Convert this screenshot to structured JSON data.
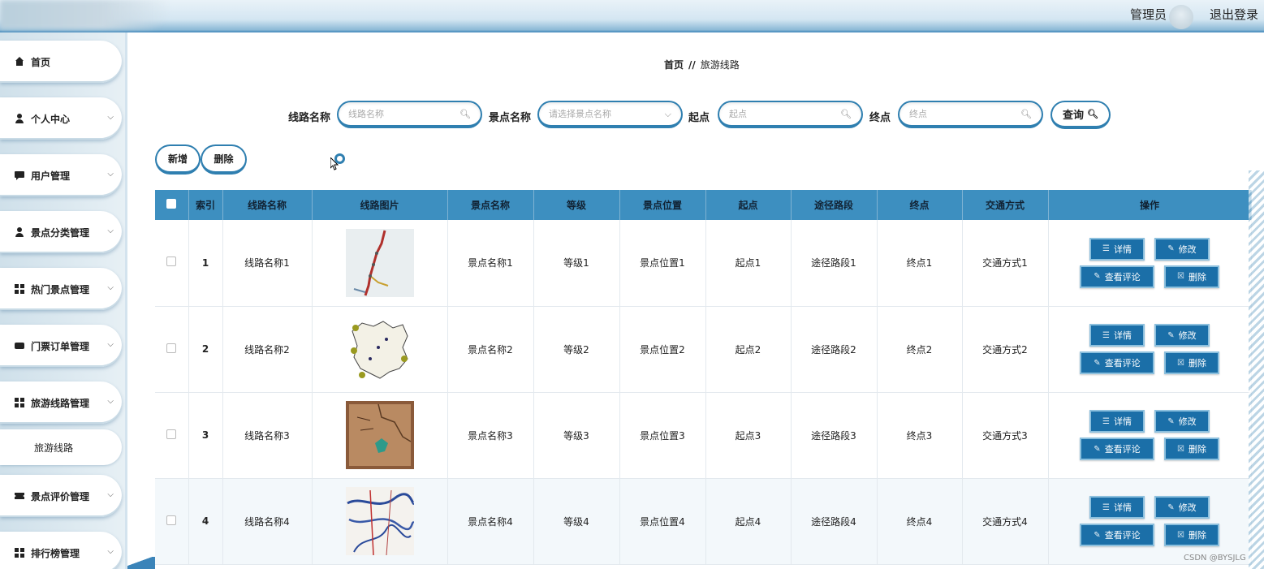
{
  "header": {
    "admin_label": "管理员",
    "logout_label": "退出登录"
  },
  "sidebar": {
    "items": [
      {
        "label": "首页",
        "icon": "home-icon",
        "expandable": false
      },
      {
        "label": "个人中心",
        "icon": "user-icon",
        "expandable": true
      },
      {
        "label": "用户管理",
        "icon": "chat-icon",
        "expandable": true
      },
      {
        "label": "景点分类管理",
        "icon": "user-icon",
        "expandable": true
      },
      {
        "label": "热门景点管理",
        "icon": "grid-icon",
        "expandable": true
      },
      {
        "label": "门票订单管理",
        "icon": "ticket-icon",
        "expandable": true
      },
      {
        "label": "旅游线路管理",
        "icon": "grid-icon",
        "expandable": true
      },
      {
        "label": "景点评价管理",
        "icon": "ticket-icon",
        "expandable": true
      },
      {
        "label": "排行榜管理",
        "icon": "grid-icon",
        "expandable": true
      }
    ],
    "submenu": {
      "label": "旅游线路"
    }
  },
  "breadcrumb": {
    "home": "首页",
    "separator": "//",
    "current": "旅游线路"
  },
  "search": {
    "route_name_label": "线路名称",
    "route_name_placeholder": "线路名称",
    "spot_name_label": "景点名称",
    "spot_name_placeholder": "请选择景点名称",
    "start_label": "起点",
    "start_placeholder": "起点",
    "end_label": "终点",
    "end_placeholder": "终点",
    "query_label": "查询"
  },
  "toolbar": {
    "add_label": "新增",
    "delete_label": "删除"
  },
  "table": {
    "headers": [
      "",
      "索引",
      "线路名称",
      "线路图片",
      "景点名称",
      "等级",
      "景点位置",
      "起点",
      "途径路段",
      "终点",
      "交通方式",
      "操作"
    ],
    "rows": [
      {
        "index": "1",
        "route": "线路名称1",
        "spot": "景点名称1",
        "level": "等级1",
        "location": "景点位置1",
        "start": "起点1",
        "via": "途径路段1",
        "end": "终点1",
        "transport": "交通方式1"
      },
      {
        "index": "2",
        "route": "线路名称2",
        "spot": "景点名称2",
        "level": "等级2",
        "location": "景点位置2",
        "start": "起点2",
        "via": "途径路段2",
        "end": "终点2",
        "transport": "交通方式2"
      },
      {
        "index": "3",
        "route": "线路名称3",
        "spot": "景点名称3",
        "level": "等级3",
        "location": "景点位置3",
        "start": "起点3",
        "via": "途径路段3",
        "end": "终点3",
        "transport": "交通方式3"
      },
      {
        "index": "4",
        "route": "线路名称4",
        "spot": "景点名称4",
        "level": "等级4",
        "location": "景点位置4",
        "start": "起点4",
        "via": "途径路段4",
        "end": "终点4",
        "transport": "交通方式4"
      }
    ],
    "actions": {
      "detail": "详情",
      "edit": "修改",
      "comments": "查看评论",
      "delete": "删除"
    }
  },
  "watermark": "CSDN @BYSJLG",
  "colors": {
    "accent": "#2f7fb0",
    "header_bg": "#3d8fc0",
    "action_btn": "#1b6fa8"
  }
}
